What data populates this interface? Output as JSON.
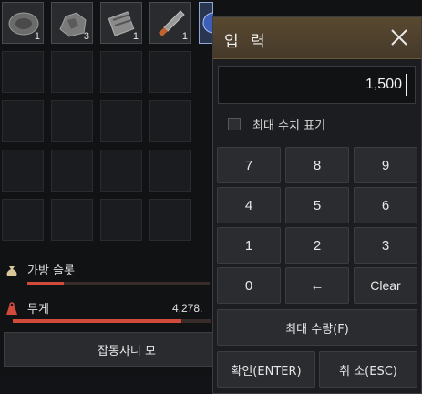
{
  "inventory": {
    "slots_row1": [
      {
        "icon": "circular-plate-icon",
        "qty": "1"
      },
      {
        "icon": "rock-ore-icon",
        "qty": "3"
      },
      {
        "icon": "scroll-bundle-icon",
        "qty": "1"
      },
      {
        "icon": "dagger-icon",
        "qty": "1"
      },
      {
        "icon": "orb-icon",
        "qty": ""
      }
    ],
    "bag_slot_label": "가방 슬롯",
    "weight_label": "무게",
    "weight_value": "4,278.",
    "sort_button": "잡동사니 모",
    "bag_fill": 0.2,
    "weight_fill": 0.85
  },
  "dialog": {
    "title": "입 력",
    "value": "1,500",
    "show_max_label": "최대 수치 표기",
    "keys": [
      "7",
      "8",
      "9",
      "4",
      "5",
      "6",
      "1",
      "2",
      "3",
      "0",
      "←",
      "Clear"
    ],
    "max_qty": "최대 수량(F)",
    "confirm": "확인(ENTER)",
    "cancel": "취 소(ESC)"
  },
  "colors": {
    "header": "#58492f",
    "accent_red": "#d14a3c",
    "button": "#2b2c30"
  }
}
